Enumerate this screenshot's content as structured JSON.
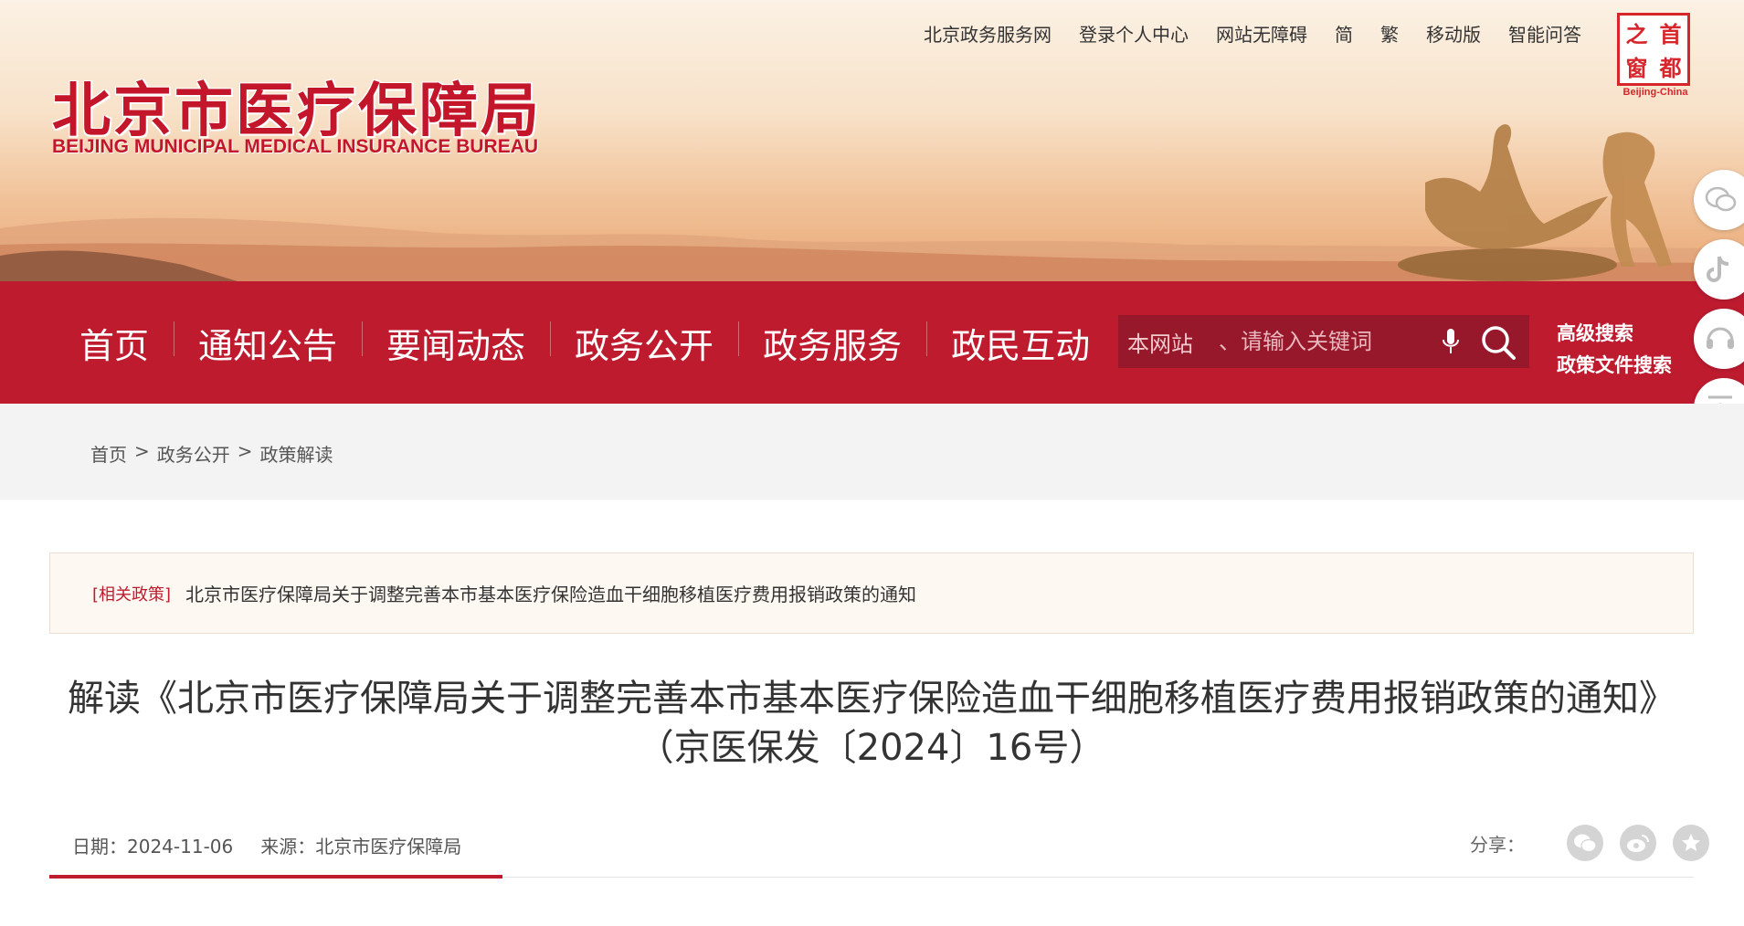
{
  "header": {
    "logo_cn": "北京市医疗保障局",
    "logo_en": "BEIJING MUNICIPAL MEDICAL INSURANCE BUREAU",
    "top_links": [
      "北京政务服务网",
      "登录个人中心",
      "网站无障碍",
      "简",
      "繁",
      "移动版",
      "智能问答"
    ],
    "capital_badge": {
      "chars": [
        "之",
        "首",
        "窗",
        "都"
      ],
      "caption": "Beijing-China"
    }
  },
  "nav": {
    "items": [
      "首页",
      "通知公告",
      "要闻动态",
      "政务公开",
      "政务服务",
      "政民互动"
    ],
    "search": {
      "scope": "本网站",
      "placeholder": "、请输入关键词"
    },
    "advanced": [
      "高级搜索",
      "政策文件搜索"
    ]
  },
  "side_float": {
    "icons": [
      "wechat-icon",
      "douyin-icon",
      "headset-icon",
      "back-to-top-icon"
    ]
  },
  "breadcrumb": {
    "items": [
      "首页",
      "政务公开",
      "政策解读"
    ],
    "separator": ">"
  },
  "related": {
    "tag": "[相关政策]",
    "link": "北京市医疗保障局关于调整完善本市基本医疗保险造血干细胞移植医疗费用报销政策的通知"
  },
  "article": {
    "title": "解读《北京市医疗保障局关于调整完善本市基本医疗保险造血干细胞移植医疗费用报销政策的通知》（京医保发〔2024〕16号）",
    "date": "日期：2024-11-06",
    "source": "来源：北京市医疗保障局",
    "share_label": "分享：",
    "share_icons": [
      "wechat-share-icon",
      "weibo-share-icon",
      "favorite-star-icon"
    ]
  },
  "colors": {
    "brand_red": "#be1b2f",
    "search_bg": "#96182a"
  }
}
